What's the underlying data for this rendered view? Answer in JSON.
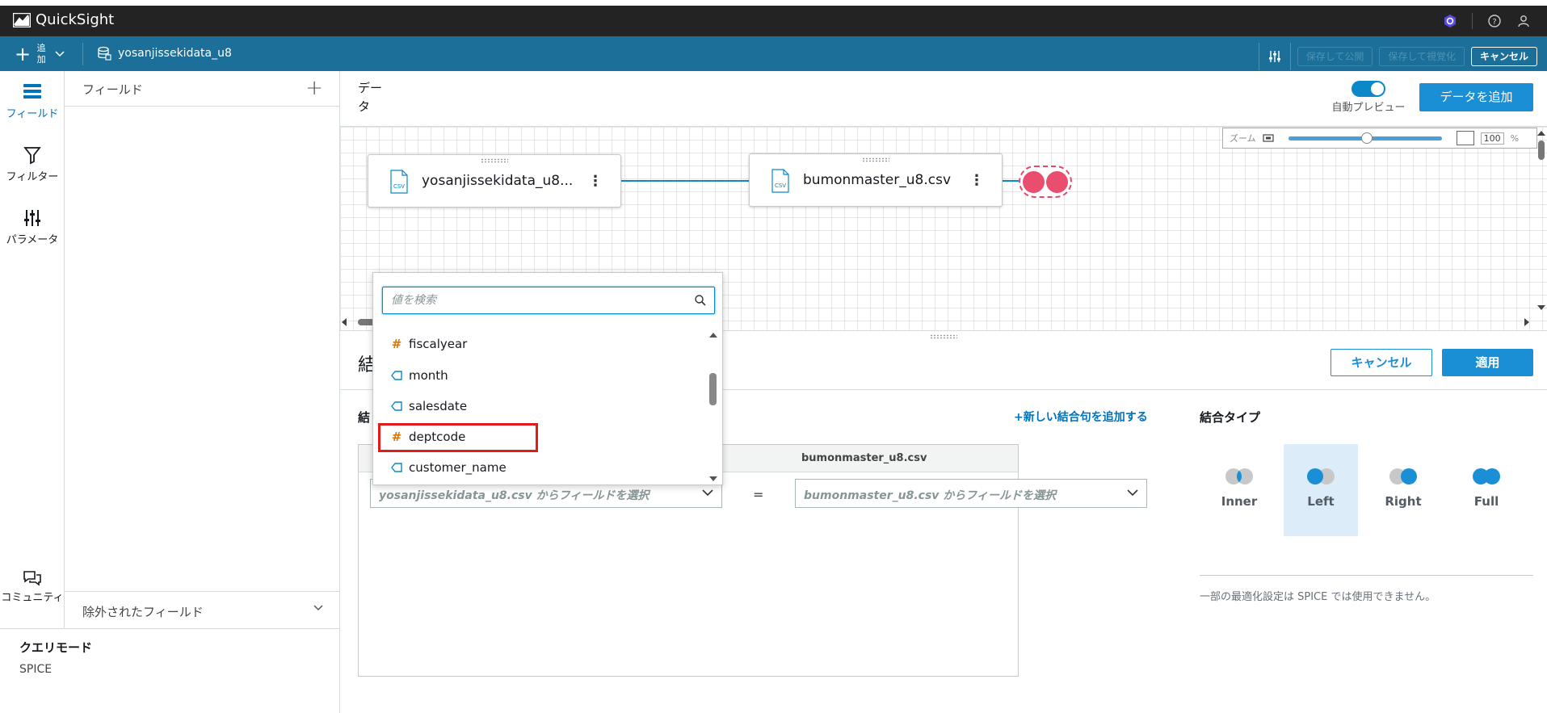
{
  "app": {
    "title": "QuickSight"
  },
  "toolbar": {
    "add_label": "追加",
    "dataset_name": "yosanjissekidata_u8",
    "save_publish": "保存して公開",
    "save_visualize": "保存して視覚化",
    "cancel": "キャンセル"
  },
  "rail": {
    "fields": "フィールド",
    "filter": "フィルター",
    "params": "パラメータ",
    "community": "コミュニティ"
  },
  "field_panel": {
    "title": "フィールド",
    "excluded": "除外されたフィールド"
  },
  "query_mode": {
    "title": "クエリモード",
    "value": "SPICE"
  },
  "main": {
    "data_title": "データ",
    "auto_preview": "自動プレビュー",
    "add_data": "データを追加"
  },
  "zoom": {
    "label": "ズーム",
    "value": "100",
    "unit": "%"
  },
  "nodes": {
    "left": "yosanjissekidata_u8...",
    "right": "bumonmaster_u8.csv",
    "csv_badge": "CSV"
  },
  "join": {
    "title": "結",
    "cancel": "キャンセル",
    "apply": "適用",
    "clauses_label": "結",
    "add_clause": "+新しい結合句を追加する",
    "right_header": "bumonmaster_u8.csv",
    "left_placeholder": "yosanjissekidata_u8.csv からフィールドを選択",
    "right_placeholder": "bumonmaster_u8.csv からフィールドを選択",
    "equals": "=",
    "type_title": "結合タイプ",
    "types": [
      "Inner",
      "Left",
      "Right",
      "Full"
    ],
    "selected_type": "Left",
    "note": "一部の最適化設定は SPICE では使用できません。"
  },
  "dropdown": {
    "search_placeholder": "値を検索",
    "items": [
      {
        "label": "fiscalyear",
        "kind": "measure"
      },
      {
        "label": "month",
        "kind": "dimension"
      },
      {
        "label": "salesdate",
        "kind": "dimension"
      },
      {
        "label": "deptcode",
        "kind": "measure"
      },
      {
        "label": "customer_name",
        "kind": "dimension"
      }
    ],
    "highlighted": "deptcode"
  },
  "colors": {
    "accent": "#1a8fd6",
    "toolbar": "#1b6f98",
    "join_circle": "#e94e6f",
    "highlight": "#e01b1b"
  }
}
